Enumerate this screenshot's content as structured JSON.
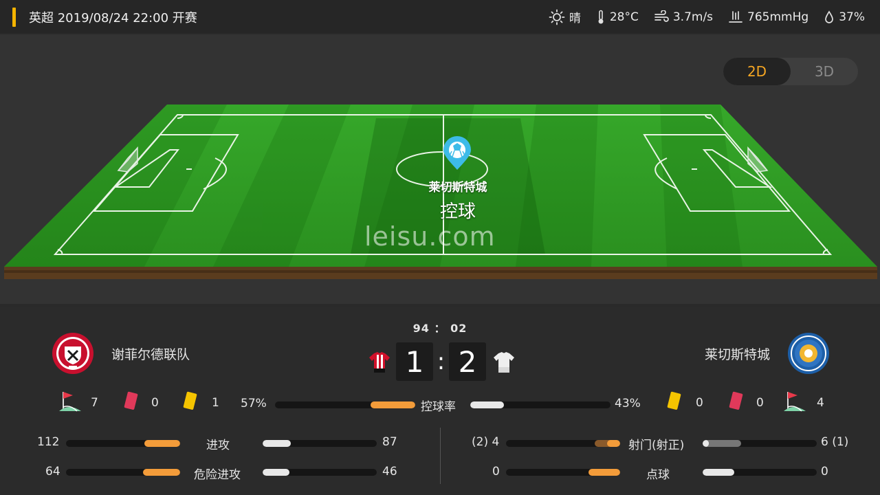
{
  "header": {
    "title": "英超 2019/08/24 22:00 开赛",
    "weather": {
      "condition": "晴",
      "temperature": "28°C",
      "wind": "3.7m/s",
      "pressure": "765mmHg",
      "humidity": "37%"
    }
  },
  "view_toggle": {
    "option_2d": "2D",
    "option_3d": "3D",
    "selected": "2D"
  },
  "pitch": {
    "possession_team": "莱切斯特城",
    "possession_state": "控球",
    "watermark": "leisu.com"
  },
  "match": {
    "timer": "94 ： 02",
    "home": {
      "name": "谢菲尔德联队",
      "score": "1"
    },
    "away": {
      "name": "莱切斯特城",
      "score": "2"
    },
    "colon": ":"
  },
  "stats": {
    "home_corners": "7",
    "home_red": "0",
    "home_yellow": "1",
    "away_yellow": "0",
    "away_red": "0",
    "away_corners": "4",
    "possession": {
      "label": "控球率",
      "home": "57%",
      "away": "43%",
      "home_value": 57,
      "away_value": 43
    },
    "attack": {
      "label": "进攻",
      "home": "112",
      "away": "87",
      "home_value": 112,
      "away_value": 87
    },
    "dangerous_attack": {
      "label": "危险进攻",
      "home": "64",
      "away": "46",
      "home_value": 64,
      "away_value": 46
    },
    "shots": {
      "label": "射门(射正)",
      "home": "(2) 4",
      "away": "6 (1)",
      "home_value": 4,
      "home_on_target": 2,
      "away_value": 6,
      "away_on_target": 1
    },
    "penalties": {
      "label": "点球",
      "home": "0",
      "away": "0",
      "home_value": 0,
      "away_value": 0
    }
  },
  "colors": {
    "accent": "#f5b400",
    "home_bar": "#f39c3a",
    "away_bar": "#e8e8e8",
    "pitch_green": "#2f9a22",
    "active_toggle": "#f5a623"
  },
  "icons": [
    "sun-icon",
    "thermometer-icon",
    "wind-icon",
    "pressure-icon",
    "humidity-icon",
    "corner-flag-icon",
    "red-card-icon",
    "yellow-card-icon",
    "ball-marker-icon",
    "home-kit-icon",
    "away-kit-icon",
    "home-crest-icon",
    "away-crest-icon"
  ]
}
